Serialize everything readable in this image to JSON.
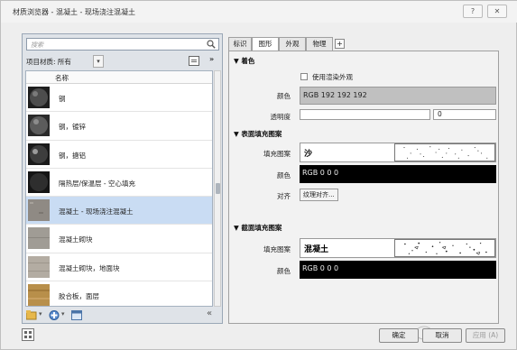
{
  "window": {
    "title": "材质浏览器 - 混凝土 - 现场浇注混凝土",
    "help_glyph": "?",
    "close_glyph": "✕"
  },
  "left": {
    "search_placeholder": "搜索",
    "filter_label": "项目材质: 所有",
    "filter_chevron": "▾",
    "expand_glyph": "»",
    "list_header": "名称",
    "materials": [
      {
        "label": "钢",
        "swatch": "#3b3b3b"
      },
      {
        "label": "钢，镀锌",
        "swatch": "#4a4a4a"
      },
      {
        "label": "钢，搪铝",
        "swatch": "#2f2f2f"
      },
      {
        "label": "隔热层/保温层 - 空心填充",
        "swatch": "#2a2a2a"
      },
      {
        "label": "混凝土 - 现场浇注混凝土",
        "swatch": "#8f8a84",
        "selected": true
      },
      {
        "label": "混凝土砌块",
        "swatch": "#a09c95"
      },
      {
        "label": "混凝土砌块，地面块",
        "swatch": "#b3aca2"
      },
      {
        "label": "胶合板，面层",
        "swatch": "#b88f4a"
      }
    ],
    "footer_collapse": "«"
  },
  "right": {
    "tabs": [
      "标识",
      "图形",
      "外观",
      "物理"
    ],
    "tab_add": "+",
    "shading": {
      "title": "▼ 着色",
      "use_render_label": "使用渲染外观",
      "color_label": "颜色",
      "color_value": "RGB 192 192 192",
      "transparency_label": "透明度",
      "transparency_value": "0"
    },
    "surface": {
      "title": "▼ 表面填充图案",
      "fill_label": "填充图案",
      "fill_value": "沙",
      "color_label": "颜色",
      "color_value": "RGB 0 0 0",
      "align_label": "对齐",
      "align_button": "纹理对齐..."
    },
    "cut": {
      "title": "▼ 截面填充图案",
      "fill_label": "填充图案",
      "fill_value": "混凝土",
      "color_label": "颜色",
      "color_value": "RGB 0 0 0"
    }
  },
  "buttons": {
    "ok": "确定",
    "cancel": "取消",
    "apply": "应用 (A)"
  },
  "colors": {
    "selected_row": "#c9dcf3",
    "shading_color": "#c0c0c0",
    "pattern_color": "#000000"
  }
}
